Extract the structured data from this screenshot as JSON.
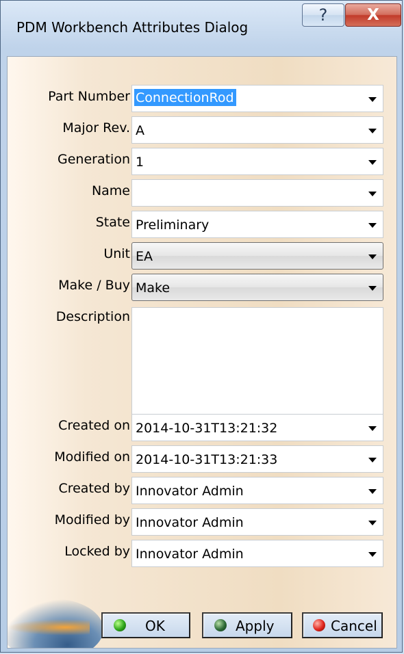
{
  "window": {
    "title": "PDM Workbench Attributes Dialog",
    "help_glyph": "?",
    "close_glyph": "X"
  },
  "fields": {
    "part_number": {
      "label": "Part Number",
      "value": "ConnectionRod"
    },
    "major_rev": {
      "label": "Major Rev.",
      "value": "A"
    },
    "generation": {
      "label": "Generation",
      "value": "1"
    },
    "name": {
      "label": "Name",
      "value": ""
    },
    "state": {
      "label": "State",
      "value": "Preliminary"
    },
    "unit": {
      "label": "Unit",
      "value": "EA"
    },
    "make_buy": {
      "label": "Make / Buy",
      "value": "Make"
    },
    "description": {
      "label": "Description",
      "value": ""
    },
    "created_on": {
      "label": "Created on",
      "value": "2014-10-31T13:21:32"
    },
    "modified_on": {
      "label": "Modified on",
      "value": "2014-10-31T13:21:33"
    },
    "created_by": {
      "label": "Created by",
      "value": "Innovator Admin"
    },
    "modified_by": {
      "label": "Modified by",
      "value": "Innovator Admin"
    },
    "locked_by": {
      "label": "Locked by",
      "value": "Innovator Admin"
    }
  },
  "buttons": {
    "ok": "OK",
    "apply": "Apply",
    "cancel": "Cancel"
  },
  "icons": {
    "help": "question-mark-icon",
    "close": "close-icon",
    "dropdown": "chevron-down-icon",
    "ok": "green-dot-icon",
    "apply": "dark-green-dot-icon",
    "cancel": "red-dot-icon"
  },
  "colors": {
    "selection": "#3399ff",
    "close_button": "#c23b2a",
    "dialog_background": "#f0ddc2"
  }
}
